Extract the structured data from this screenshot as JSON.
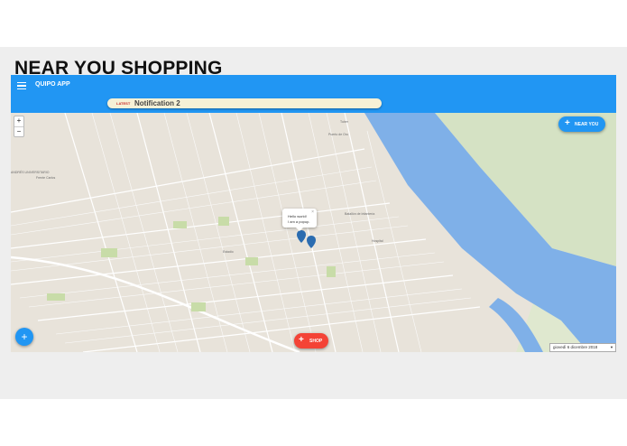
{
  "slide": {
    "title": "NEAR YOU SHOPPING"
  },
  "app": {
    "title": "QUIPO APP",
    "menu_icon": "hamburger-menu-icon",
    "notification": {
      "badge": "LATEST",
      "text": "Notification 2"
    },
    "zoom": {
      "in_label": "+",
      "out_label": "−"
    },
    "near_button": {
      "icon": "plus-icon",
      "label": "NEAR YOU"
    },
    "shop_button": {
      "icon": "plus-icon",
      "label": "SHOP"
    },
    "fab": {
      "icon": "plus-icon",
      "label": "+"
    },
    "popup": {
      "title": "Hello world!",
      "body": "I am a popup.",
      "close": "×"
    },
    "date_select": {
      "value": "giovedì 6 dicembre 2018",
      "arrow": "▼"
    },
    "map_labels": [
      "Puerto de Oro",
      "Batallón de Infantería",
      "Tuber",
      "Frente Carlos",
      "ANDRÉS UNIVERSITARIO",
      "Hospital",
      "Estadio"
    ],
    "colors": {
      "appbar": "#2196f3",
      "shop": "#f44336",
      "river": "#7fb0e8",
      "map_bg": "#e8e3da"
    }
  }
}
